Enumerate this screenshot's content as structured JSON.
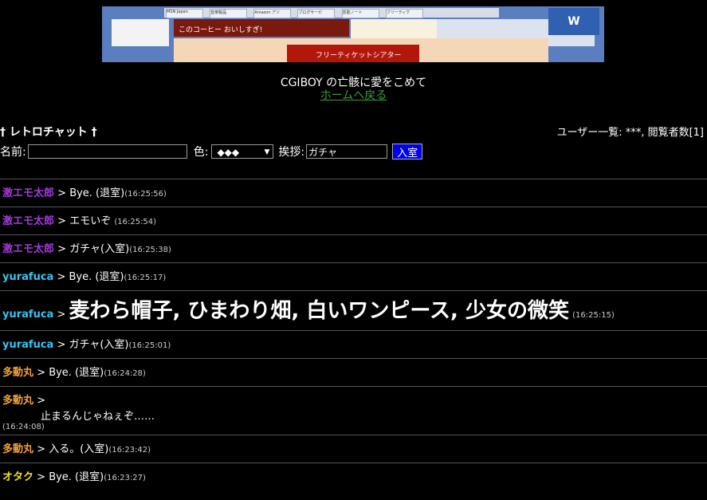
{
  "banner": {
    "tabs": [
      "MSN Japan",
      "音楽製品",
      "Amazon アソ",
      "ブログサービ",
      "芸能ノート",
      "フリーティケ"
    ],
    "ad_text": "このコーヒー おいしすぎ!",
    "theater_text": "フリーティケットシアター",
    "logo_text": "W"
  },
  "header": {
    "site_title": "CGIBOY の亡骸に愛をこめて",
    "home_link": "ホームへ戻る"
  },
  "chat": {
    "title": "† レトロチャット †",
    "users_info": "ユーザー一覧: ***,  閲覧者数[1]"
  },
  "form": {
    "name_label": "名前:",
    "name_value": "",
    "color_label": "色:",
    "color_value": "◆◆◆",
    "greeting_label": "挨拶:",
    "greeting_value": "ガチャ",
    "enter_button": "入室"
  },
  "messages": [
    {
      "user": "激エモ太郎",
      "color": "#a23ad8",
      "text": "Bye. (退室)",
      "time": "(16:25:56)"
    },
    {
      "user": "激エモ太郎",
      "color": "#a23ad8",
      "text": "エモいぞ",
      "time": "(16:25:54)"
    },
    {
      "user": "激エモ太郎",
      "color": "#a23ad8",
      "text": "ガチャ(入室)",
      "time": "(16:25:38)"
    },
    {
      "user": "yurafuca",
      "color": "#34c4f2",
      "text": "Bye. (退室)",
      "time": "(16:25:17)"
    },
    {
      "user": "yurafuca",
      "color": "#34c4f2",
      "text": "麦わら帽子, ひまわり畑, 白いワンピース, 少女の微笑",
      "time": "(16:25:15)"
    },
    {
      "user": "yurafuca",
      "color": "#34c4f2",
      "text": "ガチャ(入室)",
      "time": "(16:25:01)"
    },
    {
      "user": "多動丸",
      "color": "#f2a038",
      "text": "Bye. (退室)",
      "time": "(16:24:28)"
    },
    {
      "user": "多動丸",
      "color": "#f2a038",
      "text": "止まるんじゃねぇぞ……",
      "time": "(16:24:08)"
    },
    {
      "user": "多動丸",
      "color": "#f2a038",
      "text": "入る。(入室)",
      "time": "(16:23:42)"
    },
    {
      "user": "オタク",
      "color": "#f2e01c",
      "text": "Bye. (退室)",
      "time": "(16:23:27)"
    }
  ]
}
